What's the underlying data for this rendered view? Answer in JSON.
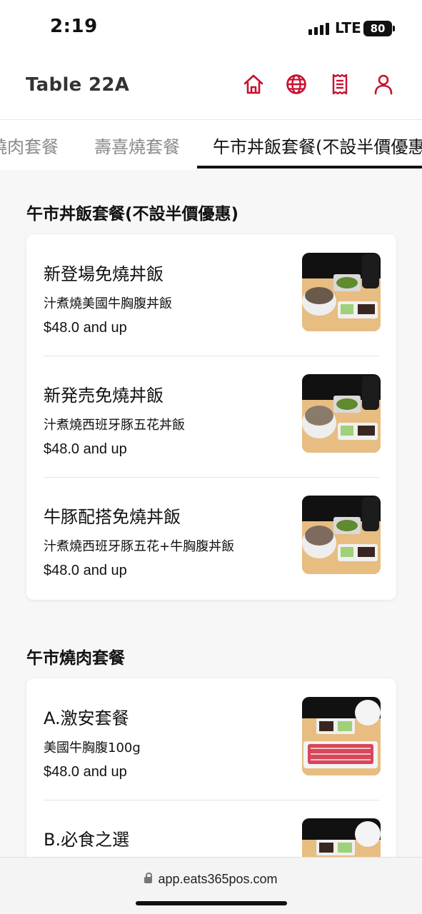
{
  "status_bar": {
    "time": "2:19",
    "network": "LTE",
    "battery": "80"
  },
  "header": {
    "table_title": "Table 22A",
    "icons": [
      "home-icon",
      "globe-icon",
      "receipt-icon",
      "user-icon"
    ],
    "accent_color": "#c8102e"
  },
  "tabs": [
    {
      "label": "燒肉套餐"
    },
    {
      "label": "壽喜燒套餐"
    },
    {
      "label": "午市丼飯套餐(不設半價優惠"
    }
  ],
  "sections": [
    {
      "title": "午市丼飯套餐(不設半價優惠)",
      "items": [
        {
          "name": "新登場免燒丼飯",
          "desc": "汁煮燒美國牛胸腹丼飯",
          "price": "$48.0 and up"
        },
        {
          "name": "新発売免燒丼飯",
          "desc": "汁煮燒西班牙豚五花丼飯",
          "price": "$48.0 and up"
        },
        {
          "name": "牛豚配搭免燒丼飯",
          "desc": "汁煮燒西班牙豚五花+牛胸腹丼飯",
          "price": "$48.0 and up"
        }
      ]
    },
    {
      "title": "午市燒肉套餐",
      "items": [
        {
          "name": "A.激安套餐",
          "desc": "美國牛胸腹100g",
          "price": "$48.0 and up"
        },
        {
          "name": "B.必食之選",
          "desc": "",
          "price": ""
        }
      ]
    }
  ],
  "browser": {
    "url": "app.eats365pos.com"
  }
}
